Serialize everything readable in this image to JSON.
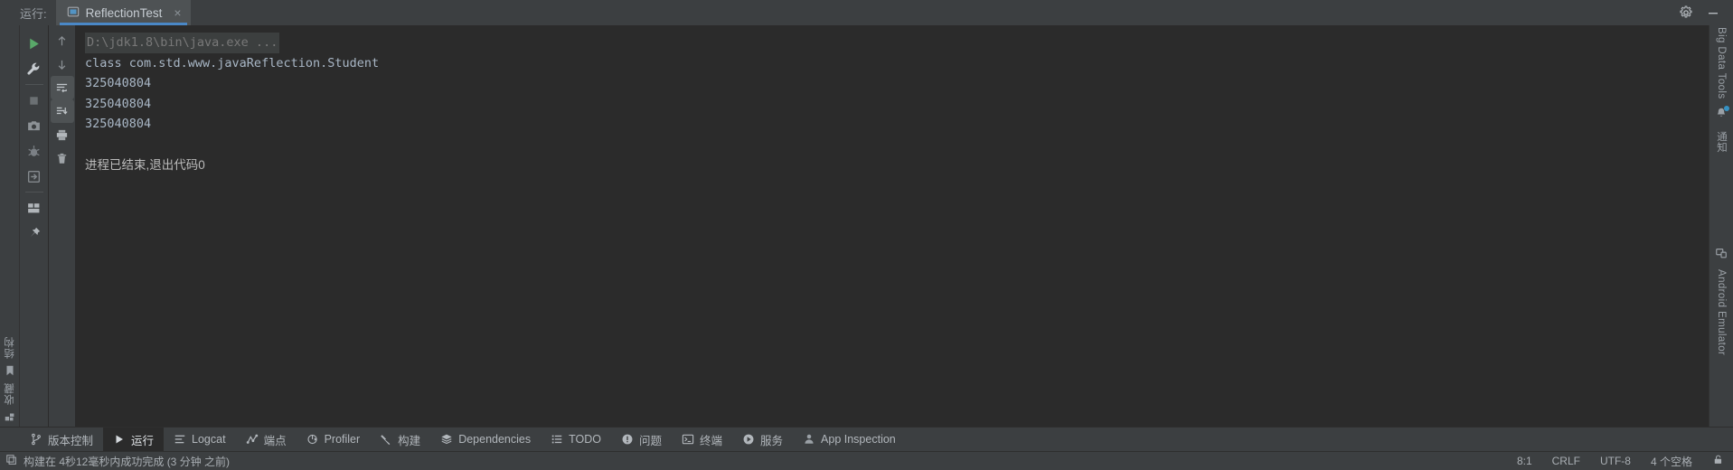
{
  "window": {
    "run_label": "运行:",
    "tab_title": "ReflectionTest",
    "tab_close": "×"
  },
  "run_toolbar": [
    {
      "name": "rerun-button",
      "icon": "play-icon",
      "label": "重新运行"
    },
    {
      "name": "edit-configurations-button",
      "icon": "wrench-icon",
      "label": "编辑配置"
    },
    {
      "name": "stop-button",
      "icon": "stop-icon",
      "label": "停止"
    },
    {
      "name": "screenshot-button",
      "icon": "camera-icon",
      "label": "屏幕截图"
    },
    {
      "name": "debug-button",
      "icon": "bug-icon",
      "label": "调试"
    },
    {
      "name": "attach-debugger-button",
      "icon": "attach-icon",
      "label": "附加调试器"
    },
    {
      "name": "layout-settings-button",
      "icon": "layout-icon",
      "label": "布局设置"
    },
    {
      "name": "pin-tab-button",
      "icon": "pin-icon",
      "label": "固定标签页"
    }
  ],
  "console_toolbar": [
    {
      "name": "prev-occurrence-button",
      "icon": "arrow-up-icon",
      "label": "上一个"
    },
    {
      "name": "next-occurrence-button",
      "icon": "arrow-down-icon",
      "label": "下一个"
    },
    {
      "name": "soft-wrap-button",
      "icon": "soft-wrap-icon",
      "label": "软换行"
    },
    {
      "name": "scroll-to-end-button",
      "icon": "scroll-to-end-icon",
      "label": "滚动到末尾"
    },
    {
      "name": "print-button",
      "icon": "printer-icon",
      "label": "打印"
    },
    {
      "name": "clear-all-button",
      "icon": "trash-icon",
      "label": "全部清除"
    }
  ],
  "console": {
    "lines": [
      {
        "text": "D:\\jdk1.8\\bin\\java.exe ...",
        "style": "cmd"
      },
      {
        "text": "class com.std.www.javaReflection.Student",
        "style": "out"
      },
      {
        "text": "325040804",
        "style": "out"
      },
      {
        "text": "325040804",
        "style": "out"
      },
      {
        "text": "325040804",
        "style": "out"
      },
      {
        "text": "",
        "style": "blank"
      },
      {
        "text": "进程已结束,退出代码0",
        "style": "zh"
      }
    ]
  },
  "left_strip": {
    "structure_label": "结构",
    "bookmarks_label": "收藏"
  },
  "right_strip": {
    "big_data_tools_label": "Big Data Tools",
    "notifications_label": "通知",
    "android_emulator_label": "Android Emulator"
  },
  "bottom_toolwindows": [
    {
      "name": "toolwindow-version-control",
      "icon": "branch-icon",
      "label": "版本控制",
      "selected": false
    },
    {
      "name": "toolwindow-run",
      "icon": "play-icon",
      "label": "运行",
      "selected": true
    },
    {
      "name": "toolwindow-logcat",
      "icon": "logcat-icon",
      "label": "Logcat",
      "selected": false
    },
    {
      "name": "toolwindow-endpoints",
      "icon": "endpoints-icon",
      "label": "端点",
      "selected": false
    },
    {
      "name": "toolwindow-profiler",
      "icon": "profiler-icon",
      "label": "Profiler",
      "selected": false
    },
    {
      "name": "toolwindow-build",
      "icon": "hammer-icon",
      "label": "构建",
      "selected": false
    },
    {
      "name": "toolwindow-dependencies",
      "icon": "layers-icon",
      "label": "Dependencies",
      "selected": false
    },
    {
      "name": "toolwindow-todo",
      "icon": "todo-list-icon",
      "label": "TODO",
      "selected": false
    },
    {
      "name": "toolwindow-problems",
      "icon": "warning-icon",
      "label": "问题",
      "selected": false
    },
    {
      "name": "toolwindow-terminal",
      "icon": "terminal-icon",
      "label": "终端",
      "selected": false
    },
    {
      "name": "toolwindow-services",
      "icon": "services-icon",
      "label": "服务",
      "selected": false
    },
    {
      "name": "toolwindow-app-inspection",
      "icon": "inspection-icon",
      "label": "App Inspection",
      "selected": false
    }
  ],
  "statusbar": {
    "build_message": "构建在 4秒12毫秒内成功完成 (3 分钟 之前)",
    "caret_position": "8:1",
    "line_separator": "CRLF",
    "encoding": "UTF-8",
    "indent": "4 个空格"
  },
  "colors": {
    "accent": "#4a88c7",
    "console_bg": "#2b2b2b",
    "chrome_bg": "#3c3f41",
    "console_text": "#a9b7c6",
    "run_green": "#59a869"
  }
}
